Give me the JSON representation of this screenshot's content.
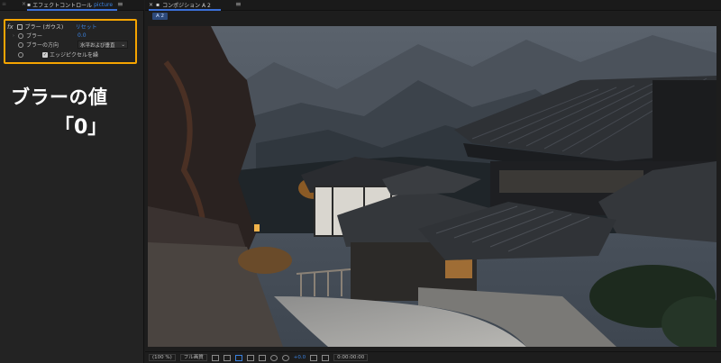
{
  "left_panel": {
    "tab": {
      "title": "エフェクトコントロール",
      "comp": "picture",
      "menu_icon": "hamburger-icon"
    },
    "effect": {
      "fx": "fx",
      "name": "ブラー (ガウス)",
      "reset": "リセット",
      "properties": {
        "blur_label": "ブラー",
        "blur_value": "0.0",
        "direction_label": "ブラーの方向",
        "direction_value": "水平および垂直",
        "edge_label": "エッジピクセルを繰"
      }
    },
    "annotation": {
      "line1": "ブラーの値",
      "line2": "「0」",
      "highlight_color": "#f5a400"
    }
  },
  "comp_panel": {
    "tab": {
      "title": "コンポジション A 2",
      "menu_icon": "hamburger-icon"
    },
    "subtab": "A 2",
    "bottom_bar": {
      "zoom": "(100 %)",
      "resolution": "フル画質",
      "exposure": "+0.0",
      "timecode": "0:00:00:00"
    }
  },
  "accent_color": "#3b82e0"
}
